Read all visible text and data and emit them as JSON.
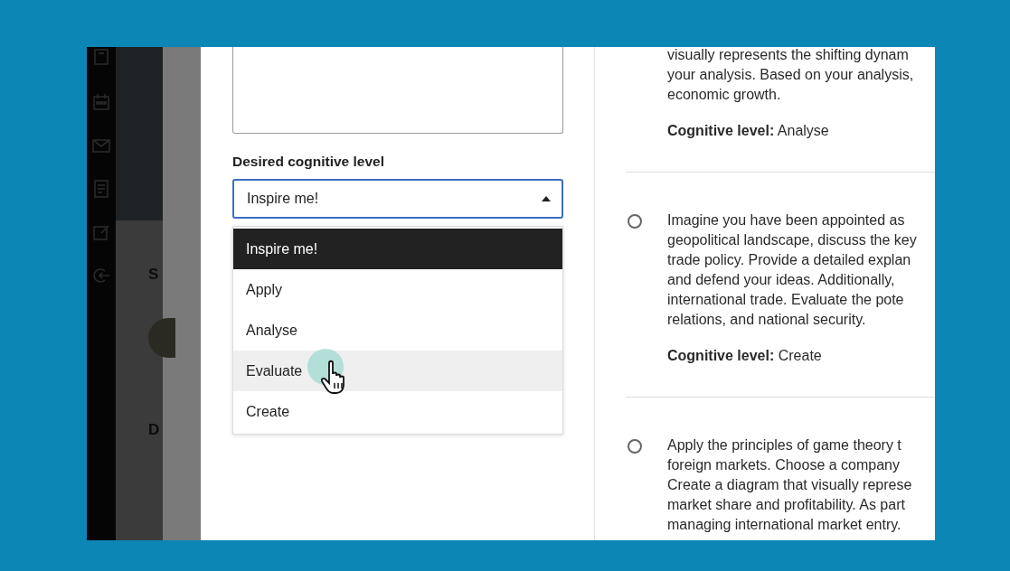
{
  "background_page": {
    "headings": [
      "S",
      "D"
    ]
  },
  "form": {
    "cognitive_level": {
      "label": "Desired cognitive level",
      "value": "Inspire me!",
      "expanded": true,
      "options": [
        {
          "label": "Inspire me!",
          "selected": true,
          "hovered": false
        },
        {
          "label": "Apply",
          "selected": false,
          "hovered": false
        },
        {
          "label": "Analyse",
          "selected": false,
          "hovered": false
        },
        {
          "label": "Evaluate",
          "selected": false,
          "hovered": true
        },
        {
          "label": "Create",
          "selected": false,
          "hovered": false
        }
      ]
    }
  },
  "questions": [
    {
      "lines": [
        "visually represents the shifting dynam",
        "your analysis. Based on your analysis,",
        "economic growth."
      ],
      "level_line": "**Cognitive level:** Analyse"
    },
    {
      "checked": false,
      "lines": [
        "Imagine you have been appointed as",
        "geopolitical landscape, discuss the key",
        "trade policy. Provide a detailed explan",
        "and defend your ideas. Additionally,",
        "international trade. Evaluate the pote",
        "relations, and national security."
      ],
      "level_line": "**Cognitive level:** Create"
    },
    {
      "checked": false,
      "lines": [
        "Apply the principles of game theory t",
        "foreign markets. Choose a company",
        "Create a diagram that visually represe",
        "market share and profitability. As part",
        "managing international market entry."
      ]
    }
  ]
}
